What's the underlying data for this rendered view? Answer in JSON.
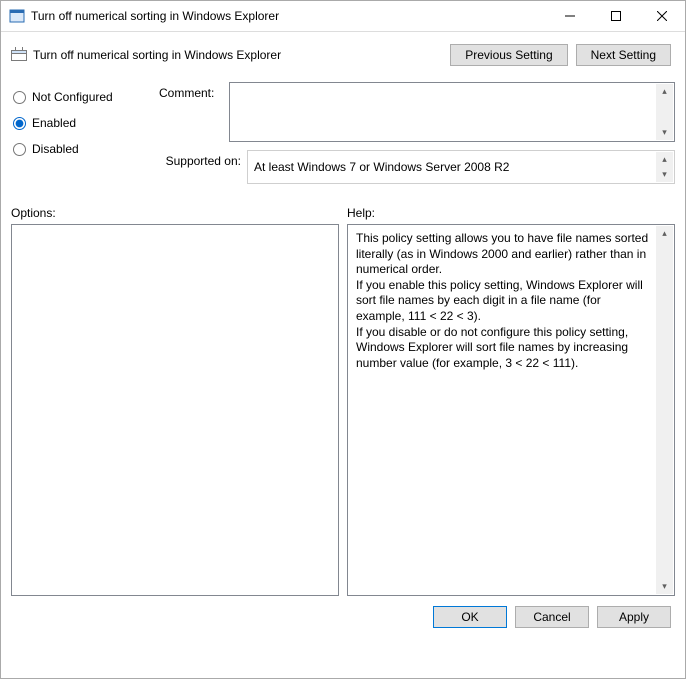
{
  "window": {
    "title": "Turn off numerical sorting in Windows Explorer"
  },
  "heading": {
    "title": "Turn off numerical sorting in Windows Explorer"
  },
  "nav_buttons": {
    "previous": "Previous Setting",
    "next": "Next Setting"
  },
  "state_radios": {
    "not_configured": "Not Configured",
    "enabled": "Enabled",
    "disabled": "Disabled",
    "selected": "enabled"
  },
  "fields": {
    "comment_label": "Comment:",
    "comment_value": "",
    "supported_label": "Supported on:",
    "supported_value": "At least Windows 7 or Windows Server 2008 R2"
  },
  "lower": {
    "options_label": "Options:",
    "help_label": "Help:",
    "help_text": "This policy setting allows you to have file names sorted literally (as in Windows 2000 and earlier) rather than in numerical order.\nIf you enable this policy setting, Windows Explorer will sort file names by each digit in a file name (for example, 111 < 22 < 3).\nIf you disable or do not configure this policy setting, Windows Explorer will sort file names by increasing number value (for example, 3 < 22 < 111)."
  },
  "dialog_buttons": {
    "ok": "OK",
    "cancel": "Cancel",
    "apply": "Apply"
  }
}
